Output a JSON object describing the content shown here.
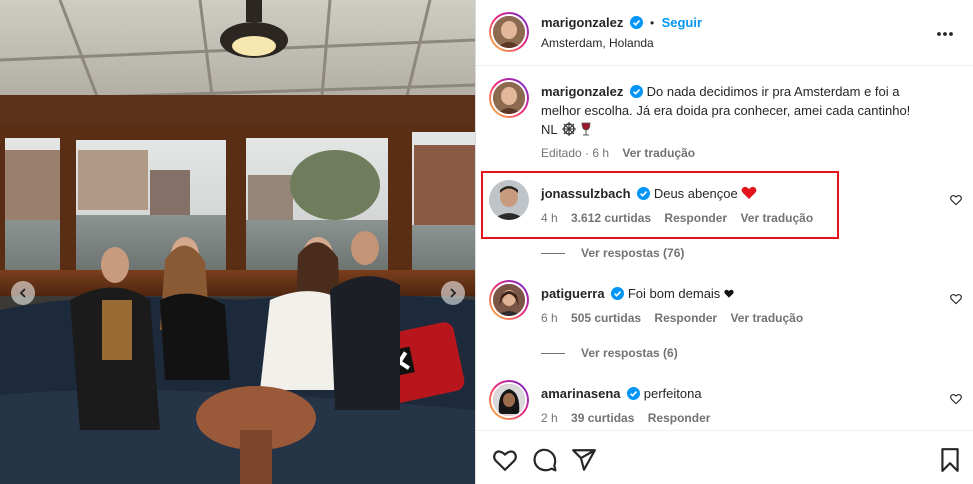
{
  "post": {
    "author": "marigonzalez",
    "follow_label": "Seguir",
    "dot": "•",
    "location": "Amsterdam, Holanda",
    "more_icon": "more-horizontal-icon"
  },
  "caption": {
    "author": "marigonzalez",
    "line1": "Do nada decidimos ir pra Amsterdam e foi a",
    "line2": "melhor escolha. Já era doida pra conhecer, amei cada cantinho!",
    "line3": "NL",
    "edited": "Editado · 6 h",
    "translate": "Ver tradução"
  },
  "comments": [
    {
      "author": "jonassulzbach",
      "text": "Deus abençoe",
      "time": "4 h",
      "likes": "3.612 curtidas",
      "reply": "Responder",
      "translate": "Ver tradução",
      "view_replies": "Ver respostas (76)"
    },
    {
      "author": "patiguerra",
      "text": "Foi bom demais",
      "time": "6 h",
      "likes": "505 curtidas",
      "reply": "Responder",
      "translate": "Ver tradução",
      "view_replies": "Ver respostas (6)"
    },
    {
      "author": "amarinasena",
      "text": "perfeitona",
      "time": "2 h",
      "likes": "39 curtidas",
      "reply": "Responder"
    }
  ],
  "colors": {
    "accent": "#0095f6",
    "verified": "#0095f6",
    "highlight": "#e3141c",
    "heart": "#e0245e"
  }
}
